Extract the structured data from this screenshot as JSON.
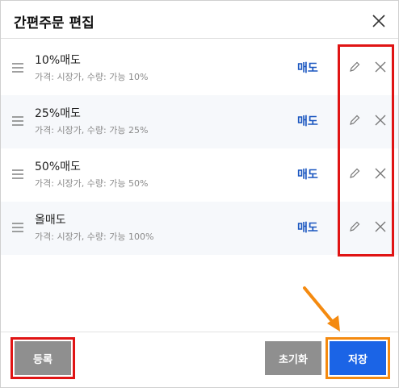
{
  "dialog": {
    "title": "간편주문 편집",
    "close_icon": "close-icon"
  },
  "orders": [
    {
      "name": "10%매도",
      "desc": "가격: 시장가, 수량: 가능 10%",
      "side": "매도"
    },
    {
      "name": "25%매도",
      "desc": "가격: 시장가, 수량: 가능 25%",
      "side": "매도"
    },
    {
      "name": "50%매도",
      "desc": "가격: 시장가, 수량: 가능 50%",
      "side": "매도"
    },
    {
      "name": "올매도",
      "desc": "가격: 시장가, 수량: 가능 100%",
      "side": "매도"
    }
  ],
  "icons": {
    "drag": "drag-handle-icon",
    "edit": "pencil-icon",
    "delete": "close-icon"
  },
  "footer": {
    "register_label": "등록",
    "reset_label": "초기화",
    "save_label": "저장"
  },
  "annotations": {
    "highlight_red": "#e01414",
    "highlight_orange": "#f48a10"
  },
  "colors": {
    "side_text": "#1a56c0",
    "save_button": "#1b64e6",
    "grey_button": "#8f8f8f"
  }
}
